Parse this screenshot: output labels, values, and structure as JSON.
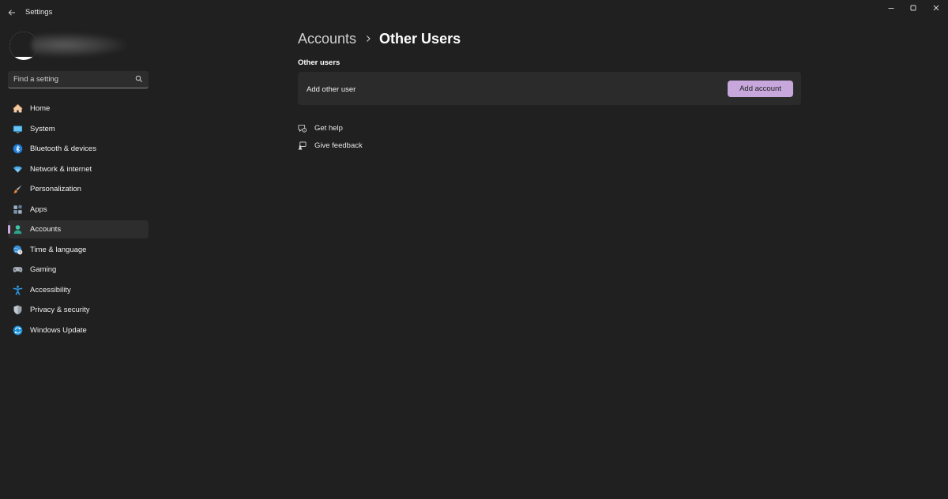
{
  "window": {
    "title": "Settings"
  },
  "sidebar": {
    "search": {
      "placeholder": "Find a setting"
    },
    "items": [
      {
        "label": "Home",
        "icon": "home-icon",
        "active": false
      },
      {
        "label": "System",
        "icon": "system-icon",
        "active": false
      },
      {
        "label": "Bluetooth & devices",
        "icon": "bluetooth-icon",
        "active": false
      },
      {
        "label": "Network & internet",
        "icon": "wifi-icon",
        "active": false
      },
      {
        "label": "Personalization",
        "icon": "brush-icon",
        "active": false
      },
      {
        "label": "Apps",
        "icon": "apps-icon",
        "active": false
      },
      {
        "label": "Accounts",
        "icon": "person-icon",
        "active": true
      },
      {
        "label": "Time & language",
        "icon": "globe-clock-icon",
        "active": false
      },
      {
        "label": "Gaming",
        "icon": "gamepad-icon",
        "active": false
      },
      {
        "label": "Accessibility",
        "icon": "accessibility-icon",
        "active": false
      },
      {
        "label": "Privacy & security",
        "icon": "shield-icon",
        "active": false
      },
      {
        "label": "Windows Update",
        "icon": "update-icon",
        "active": false
      }
    ]
  },
  "main": {
    "breadcrumb": {
      "parent": "Accounts",
      "current": "Other Users"
    },
    "section_title": "Other users",
    "card": {
      "label": "Add other user",
      "button": "Add account"
    },
    "links": [
      {
        "label": "Get help",
        "icon": "help-chat-icon"
      },
      {
        "label": "Give feedback",
        "icon": "feedback-icon"
      }
    ]
  },
  "colors": {
    "background": "#202020",
    "card": "#2b2b2b",
    "accent": "#c7a7dc"
  }
}
